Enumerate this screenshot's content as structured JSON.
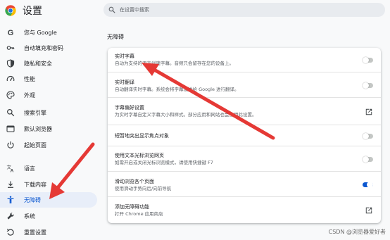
{
  "app": {
    "title": "设置"
  },
  "search": {
    "placeholder": "在设置中搜索"
  },
  "sidebar": {
    "items": [
      {
        "label": "您与 Google",
        "icon": "google-icon"
      },
      {
        "label": "自动填充和密码",
        "icon": "key-icon"
      },
      {
        "label": "隐私和安全",
        "icon": "shield-icon"
      },
      {
        "label": "性能",
        "icon": "speedometer-icon"
      },
      {
        "label": "外观",
        "icon": "palette-icon"
      },
      {
        "label": "搜索引擎",
        "icon": "search-icon"
      },
      {
        "label": "默认浏览器",
        "icon": "browser-icon"
      },
      {
        "label": "起始页面",
        "icon": "power-icon"
      },
      {
        "label": "语言",
        "icon": "translate-icon"
      },
      {
        "label": "下载内容",
        "icon": "download-icon"
      },
      {
        "label": "无障碍",
        "icon": "accessibility-icon",
        "active": true
      },
      {
        "label": "系统",
        "icon": "wrench-icon"
      },
      {
        "label": "重置设置",
        "icon": "reset-icon"
      }
    ]
  },
  "main": {
    "section_title": "无障碍",
    "settings": [
      {
        "title": "实时字幕",
        "subtitle": "自动为支持的语言创建字幕。音频只会留存在您的设备上。",
        "control": "toggle",
        "checked": false
      },
      {
        "title": "实时翻译",
        "subtitle": "自动翻译实时字幕。系统会将字幕发送给 Google 进行翻译。",
        "control": "toggle",
        "checked": false
      },
      {
        "title": "字幕偏好设置",
        "subtitle": "为实时字幕自定义字幕大小和样式。部分应用和网站也会使用此设置。",
        "control": "external-link"
      },
      {
        "title": "短暂地突出显示焦点对象",
        "subtitle": "",
        "control": "toggle",
        "checked": false
      },
      {
        "title": "使用文本光标浏览网页",
        "subtitle": "如需开启或关闭光标浏览模式，请使用快捷键 F7",
        "control": "toggle",
        "checked": false
      },
      {
        "title": "滑动浏览各个页面",
        "subtitle": "使用滑动手势向后/向前导航",
        "control": "toggle",
        "checked": true
      },
      {
        "title": "添加无障碍功能",
        "subtitle": "打开 Chrome 应用商店",
        "control": "external-link"
      }
    ]
  },
  "watermark": "CSDN @浏览器爱好者",
  "colors": {
    "accent": "#0b57d0",
    "annotation_arrow": "#e53935",
    "active_nav_bg": "#e8eef9"
  }
}
